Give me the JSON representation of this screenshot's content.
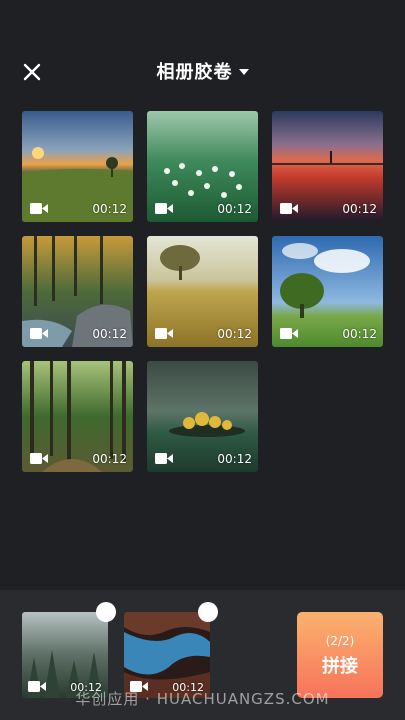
{
  "header": {
    "title": "相册胶卷",
    "close_icon": "close-icon",
    "dropdown_icon": "caret-down-icon"
  },
  "media": [
    {
      "duration": "00:12",
      "scene": "sunset-field"
    },
    {
      "duration": "00:12",
      "scene": "white-flowers"
    },
    {
      "duration": "00:12",
      "scene": "red-lake-sunset"
    },
    {
      "duration": "00:12",
      "scene": "autumn-forest-stream"
    },
    {
      "duration": "00:12",
      "scene": "tree-wheat-field"
    },
    {
      "duration": "00:12",
      "scene": "tree-blue-sky"
    },
    {
      "duration": "00:12",
      "scene": "green-forest"
    },
    {
      "duration": "00:12",
      "scene": "island-lake"
    }
  ],
  "selected": [
    {
      "duration": "00:12",
      "scene": "misty-forest"
    },
    {
      "duration": "00:12",
      "scene": "canyon-aerial"
    }
  ],
  "join_button": {
    "count": "(2/2)",
    "label": "拼接"
  },
  "watermark": "华创应用 · HUACHUANGZS.COM",
  "colors": {
    "background": "#1f2023",
    "bottom_bar": "#2a2b2e",
    "join_gradient_top": "#fbb26e",
    "join_gradient_bottom": "#f7735a"
  }
}
